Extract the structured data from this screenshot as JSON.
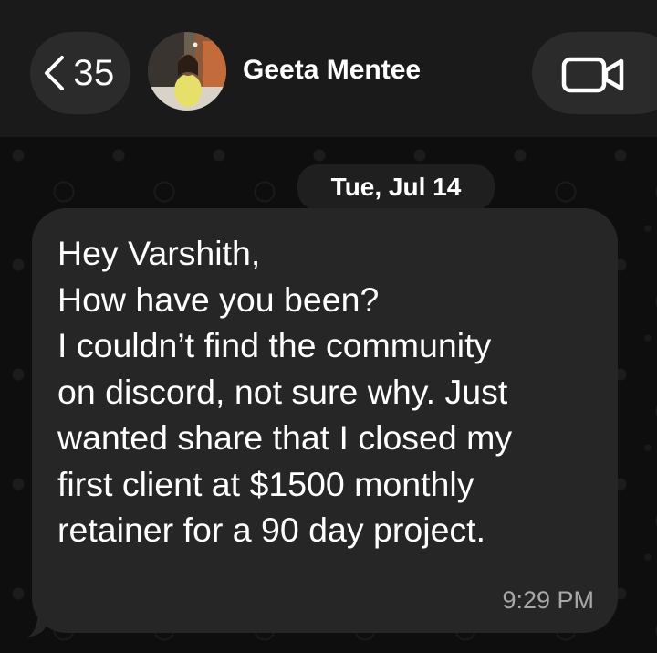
{
  "header": {
    "back_count": "35",
    "contact_name": "Geeta Mentee"
  },
  "chat": {
    "date_chip": "Tue, Jul 14",
    "message": {
      "lines": [
        "Hey Varshith,",
        "How have you been?",
        "I couldn’t find the community",
        "on discord, not sure why. Just",
        "wanted share that I closed my",
        "first client at $1500 monthly",
        "retainer for a 90 day project."
      ],
      "time": "9:29 PM"
    }
  },
  "icons": {
    "back": "chevron-left-icon",
    "video": "video-camera-icon"
  },
  "colors": {
    "header_bg": "#1a1a1a",
    "bubble_bg": "#262626",
    "pill_bg": "#2b2b2b",
    "time_text": "#a8a8a8"
  }
}
